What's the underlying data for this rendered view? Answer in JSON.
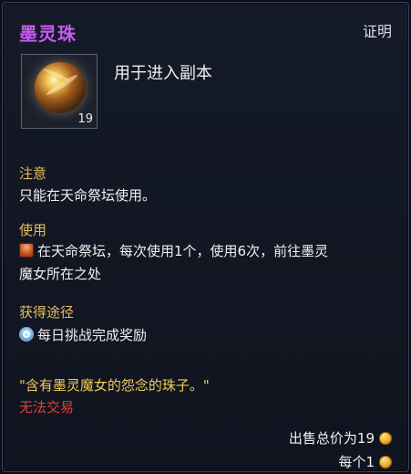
{
  "item": {
    "name": "墨灵珠",
    "category": "证明",
    "description": "用于进入副本",
    "stack_count": "19"
  },
  "sections": {
    "notice": {
      "label": "注意",
      "text": "只能在天命祭坛使用。"
    },
    "use": {
      "label": "使用",
      "line1": "在天命祭坛，每次使用1个，使用6次，前往墨灵",
      "line2": "魔女所在之处",
      "icon": "quest-icon"
    },
    "source": {
      "label": "获得途径",
      "text": "每日挑战完成奖励",
      "icon": "daily-challenge-icon"
    }
  },
  "flavor_text": "\"含有墨灵魔女的怨念的珠子。\"",
  "trade_status": "无法交易",
  "price": {
    "total": "出售总价为19",
    "each": "每个1",
    "icon": "gold-coin-icon"
  },
  "colors": {
    "title": "#c65cf0",
    "section": "#e5bf57",
    "flavor": "#f2cb5a",
    "warning": "#e43f36"
  }
}
